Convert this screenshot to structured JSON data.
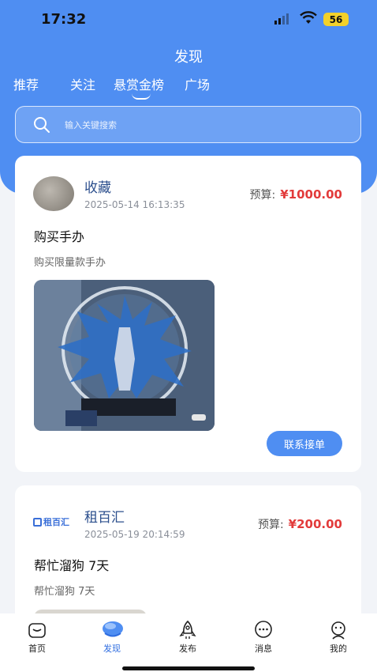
{
  "status_bar": {
    "time": "17:32",
    "battery": "56"
  },
  "header": {
    "title": "发现",
    "tabs": [
      {
        "label": "推荐"
      },
      {
        "label": "关注"
      },
      {
        "label": "悬赏金榜",
        "active": true
      },
      {
        "label": "广场"
      }
    ]
  },
  "search": {
    "placeholder": "输入关键搜索",
    "value": ""
  },
  "posts": [
    {
      "name": "收藏",
      "date": "2025-05-14 16:13:35",
      "budget_label": "预算:",
      "budget_amount": "¥1000.00",
      "title": "购买手办",
      "description": "购买限量款手办",
      "action_label": "联系接单"
    },
    {
      "name": "租百汇",
      "logo_text": "租百汇",
      "date": "2025-05-19 20:14:59",
      "budget_label": "预算:",
      "budget_amount": "¥200.00",
      "title": "帮忙溜狗 7天",
      "description": "帮忙溜狗 7天"
    }
  ],
  "bottom_nav": [
    {
      "label": "首页",
      "icon": "home-icon"
    },
    {
      "label": "发现",
      "icon": "discover-icon",
      "active": true
    },
    {
      "label": "发布",
      "icon": "rocket-icon"
    },
    {
      "label": "消息",
      "icon": "message-icon"
    },
    {
      "label": "我的",
      "icon": "profile-icon"
    }
  ],
  "colors": {
    "primary": "#4f8ef2",
    "price": "#e23b3b",
    "active_tab": "#2f6de0"
  }
}
